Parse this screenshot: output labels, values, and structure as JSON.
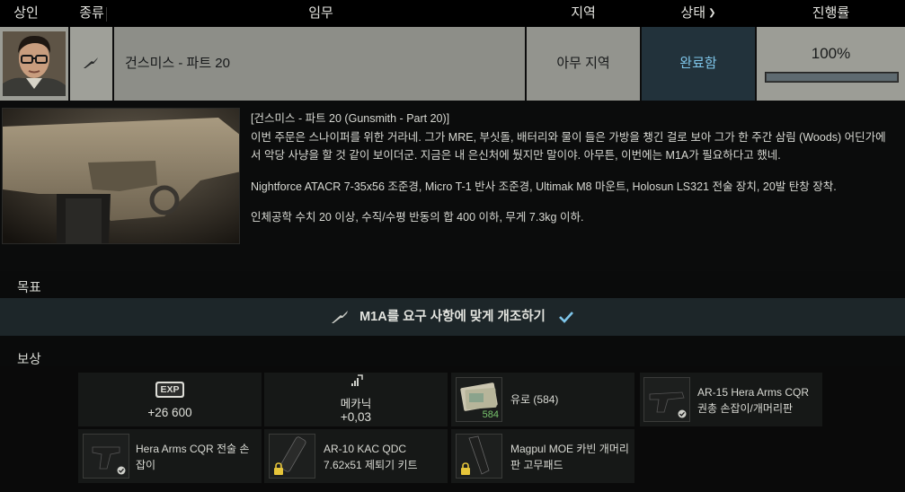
{
  "header": {
    "trader": "상인",
    "type": "종류",
    "task": "임무",
    "location": "지역",
    "status": "상태",
    "progress": "진행률"
  },
  "quest": {
    "title": "건스미스 - 파트 20",
    "location": "아무 지역",
    "status": "완료함",
    "progress_label": "100%",
    "progress_value": 1.0
  },
  "description": {
    "line1": "[건스미스 - 파트 20 (Gunsmith - Part 20)]",
    "line2": "이번 주문은 스나이퍼를 위한 거라네. 그가 MRE, 부싯돌, 배터리와 물이 들은 가방을 챙긴 걸로 보아 그가 한 주간 삼림 (Woods) 어딘가에서 악당 사냥을 할 것 같이 보이더군. 지금은 내 은신처에 뒀지만 말이야. 아무튼, 이번에는 M1A가 필요하다고 했네.",
    "para2": "Nightforce ATACR 7-35x56 조준경, Micro T-1 반사 조준경, Ultimak M8 마운트, Holosun LS321 전술 장치, 20발 탄창 장착.",
    "para3": "인체공학 수치 20 이상, 수직/수평 반동의 합 400 이하, 무게 7.3kg 이하."
  },
  "objectives": {
    "label": "목표",
    "items": [
      "M1A를 요구 사항에 맞게 개조하기"
    ]
  },
  "rewards": {
    "label": "보상",
    "exp_badge": "EXP",
    "exp_value": "+26 600",
    "skill_name": "메카닉",
    "skill_value": "+0,03",
    "money_label": "유로 (584)",
    "money_count": "584",
    "item1": "AR-15 Hera Arms CQR 권총 손잡이/개머리판",
    "item2": "Hera Arms CQR 전술 손잡이",
    "item3": "AR-10 KAC QDC 7.62x51 제퇴기 키트",
    "item4": "Magpul MOE 카빈 개머리판 고무패드"
  },
  "colors": {
    "status_bg": "#22323b",
    "status_text": "#7fc6ea",
    "objective_bg": "#1d2629",
    "check": "#7fc6ea"
  }
}
